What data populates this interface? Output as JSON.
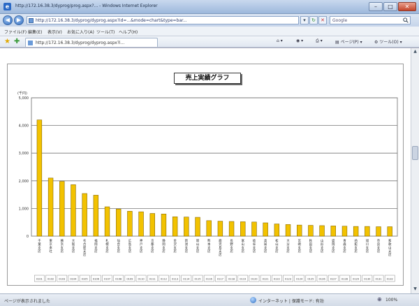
{
  "window": {
    "title": "http://172.16.38.3/dyprog/prog.aspx?... - Windows Internet Explorer",
    "icon": "ie-icon"
  },
  "address": {
    "url": "http://172.16.38.3/dyprog/dyprog.aspx?id=...&mode=chart&type=bar...",
    "search_placeholder": "Google"
  },
  "menu": {
    "items": [
      "ファイル(F)",
      "編集(E)",
      "表示(V)",
      "お気に入り(A)",
      "ツール(T)",
      "ヘルプ(H)"
    ]
  },
  "tab": {
    "label": "http://172.16.38.3/dyprog/dyprog.aspx?i..."
  },
  "toolbar": {
    "page_label": "ページ(P)",
    "tools_label": "ツール(O)"
  },
  "status": {
    "text": "ページが表示されました",
    "zone": "インターネット | 保護モード: 有効",
    "zoom": "100%"
  },
  "colors": {
    "bar_fill": "#f2c200",
    "bar_stroke": "#8a6a00",
    "grid": "#777777"
  },
  "chart_data": {
    "type": "bar",
    "title": "売上実績グラフ",
    "ylabel": "",
    "yunit": "(千円)",
    "ylim": [
      0,
      5000
    ],
    "yticks": [
      0,
      1000,
      2000,
      3000,
      4000,
      5000
    ],
    "grid": true,
    "categories": [
      "千葉支店",
      "東京本社",
      "横浜支店",
      "大阪支店",
      "名古屋支店",
      "福岡支店",
      "札幌支店",
      "仙台支店",
      "広島支店",
      "神戸支店",
      "京都支店",
      "静岡支店",
      "金沢支店",
      "新潟支店",
      "岡山支店",
      "熊本支店",
      "鹿児島支店",
      "長野支店",
      "富山支店",
      "岐阜支店",
      "高知支店",
      "松山支店",
      "大分支店",
      "宮崎支店",
      "秋田支店",
      "山形支店",
      "盛岡支店",
      "青森支店",
      "函館支店",
      "旭川支店",
      "奈良支店",
      "和歌山支店"
    ],
    "codes": [
      "0101",
      "0102",
      "0103",
      "0104",
      "0105",
      "0106",
      "0107",
      "0108",
      "0109",
      "0110",
      "0111",
      "0112",
      "0113",
      "0114",
      "0115",
      "0116",
      "0117",
      "0118",
      "0119",
      "0120",
      "0121",
      "0122",
      "0123",
      "0124",
      "0125",
      "0126",
      "0127",
      "0128",
      "0129",
      "0130",
      "0131",
      "0132"
    ],
    "values": [
      4200,
      2100,
      1980,
      1860,
      1540,
      1480,
      1060,
      980,
      900,
      880,
      820,
      800,
      700,
      690,
      680,
      560,
      540,
      530,
      520,
      510,
      480,
      440,
      420,
      400,
      390,
      380,
      370,
      360,
      350,
      350,
      340,
      340
    ]
  }
}
